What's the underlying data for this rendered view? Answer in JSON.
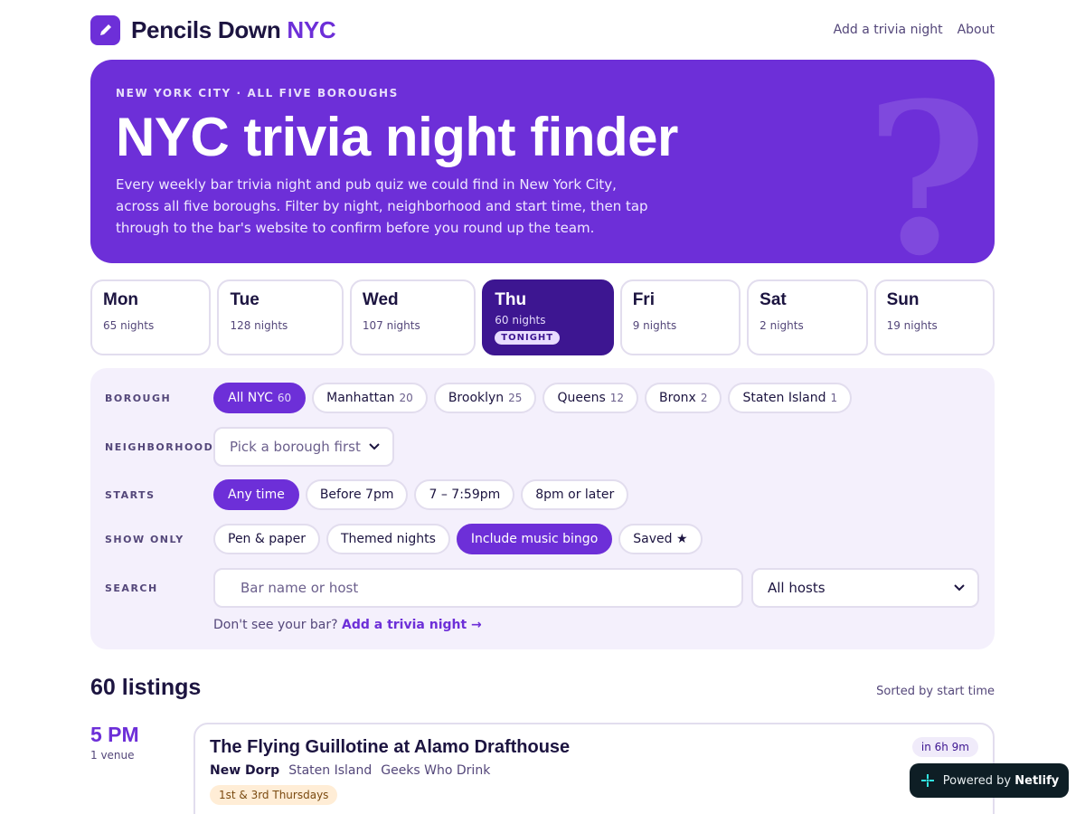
{
  "header": {
    "brand_name": "Pencils Down",
    "brand_accent": "NYC",
    "nav": [
      "Add a trivia night",
      "About"
    ]
  },
  "hero": {
    "eyebrow": "NEW YORK CITY · ALL FIVE BOROUGHS",
    "title": "NYC trivia night finder",
    "description": "Every weekly bar trivia night and pub quiz we could find in New York City, across all five boroughs. Filter by night, neighborhood and start time, then tap through to the bar's website to confirm before you round up the team.",
    "decoration": "?"
  },
  "days": [
    {
      "name": "Mon",
      "count": "65 nights"
    },
    {
      "name": "Tue",
      "count": "128 nights"
    },
    {
      "name": "Wed",
      "count": "107 nights"
    },
    {
      "name": "Thu",
      "count": "60 nights",
      "badge": "TONIGHT"
    },
    {
      "name": "Fri",
      "count": "9 nights"
    },
    {
      "name": "Sat",
      "count": "2 nights"
    },
    {
      "name": "Sun",
      "count": "19 nights"
    }
  ],
  "filters": {
    "borough_label": "BOROUGH",
    "boroughs": [
      {
        "label": "All NYC",
        "count": "60"
      },
      {
        "label": "Manhattan",
        "count": "20"
      },
      {
        "label": "Brooklyn",
        "count": "25"
      },
      {
        "label": "Queens",
        "count": "12"
      },
      {
        "label": "Bronx",
        "count": "2"
      },
      {
        "label": "Staten Island",
        "count": "1"
      }
    ],
    "neighborhood_label": "NEIGHBORHOOD",
    "neighborhood_value": "Pick a borough first",
    "starts_label": "STARTS",
    "starts": [
      "Any time",
      "Before 7pm",
      "7 – 7:59pm",
      "8pm or later"
    ],
    "show_only_label": "SHOW ONLY",
    "show_only": [
      "Pen & paper",
      "Themed nights",
      "Include music bingo",
      "Saved ★"
    ],
    "search_label": "SEARCH",
    "search_placeholder": "Bar name or host",
    "hosts_value": "All hosts",
    "helper_text": "Don't see your bar?",
    "helper_link": "Add a trivia night →"
  },
  "listings": {
    "count": "60 listings",
    "sorted": "Sorted by start time",
    "slot_time": "5 PM",
    "slot_venues": "1 venue",
    "card": {
      "title": "The Flying Guillotine at Alamo Drafthouse",
      "neighborhood": "New Dorp",
      "borough": "Staten Island",
      "host": "Geeks Who Drink",
      "schedule": "1st & 3rd Thursdays",
      "countdown": "in 6h 9m"
    }
  },
  "netlify": {
    "prefix": "Powered by",
    "name": "Netlify"
  },
  "colors": {
    "accent": "#6d2fd8",
    "accent_dark": "#3d1691",
    "ink": "#1c1440",
    "panel": "#f4f0fc",
    "schedule_bg": "#ffedd6"
  }
}
